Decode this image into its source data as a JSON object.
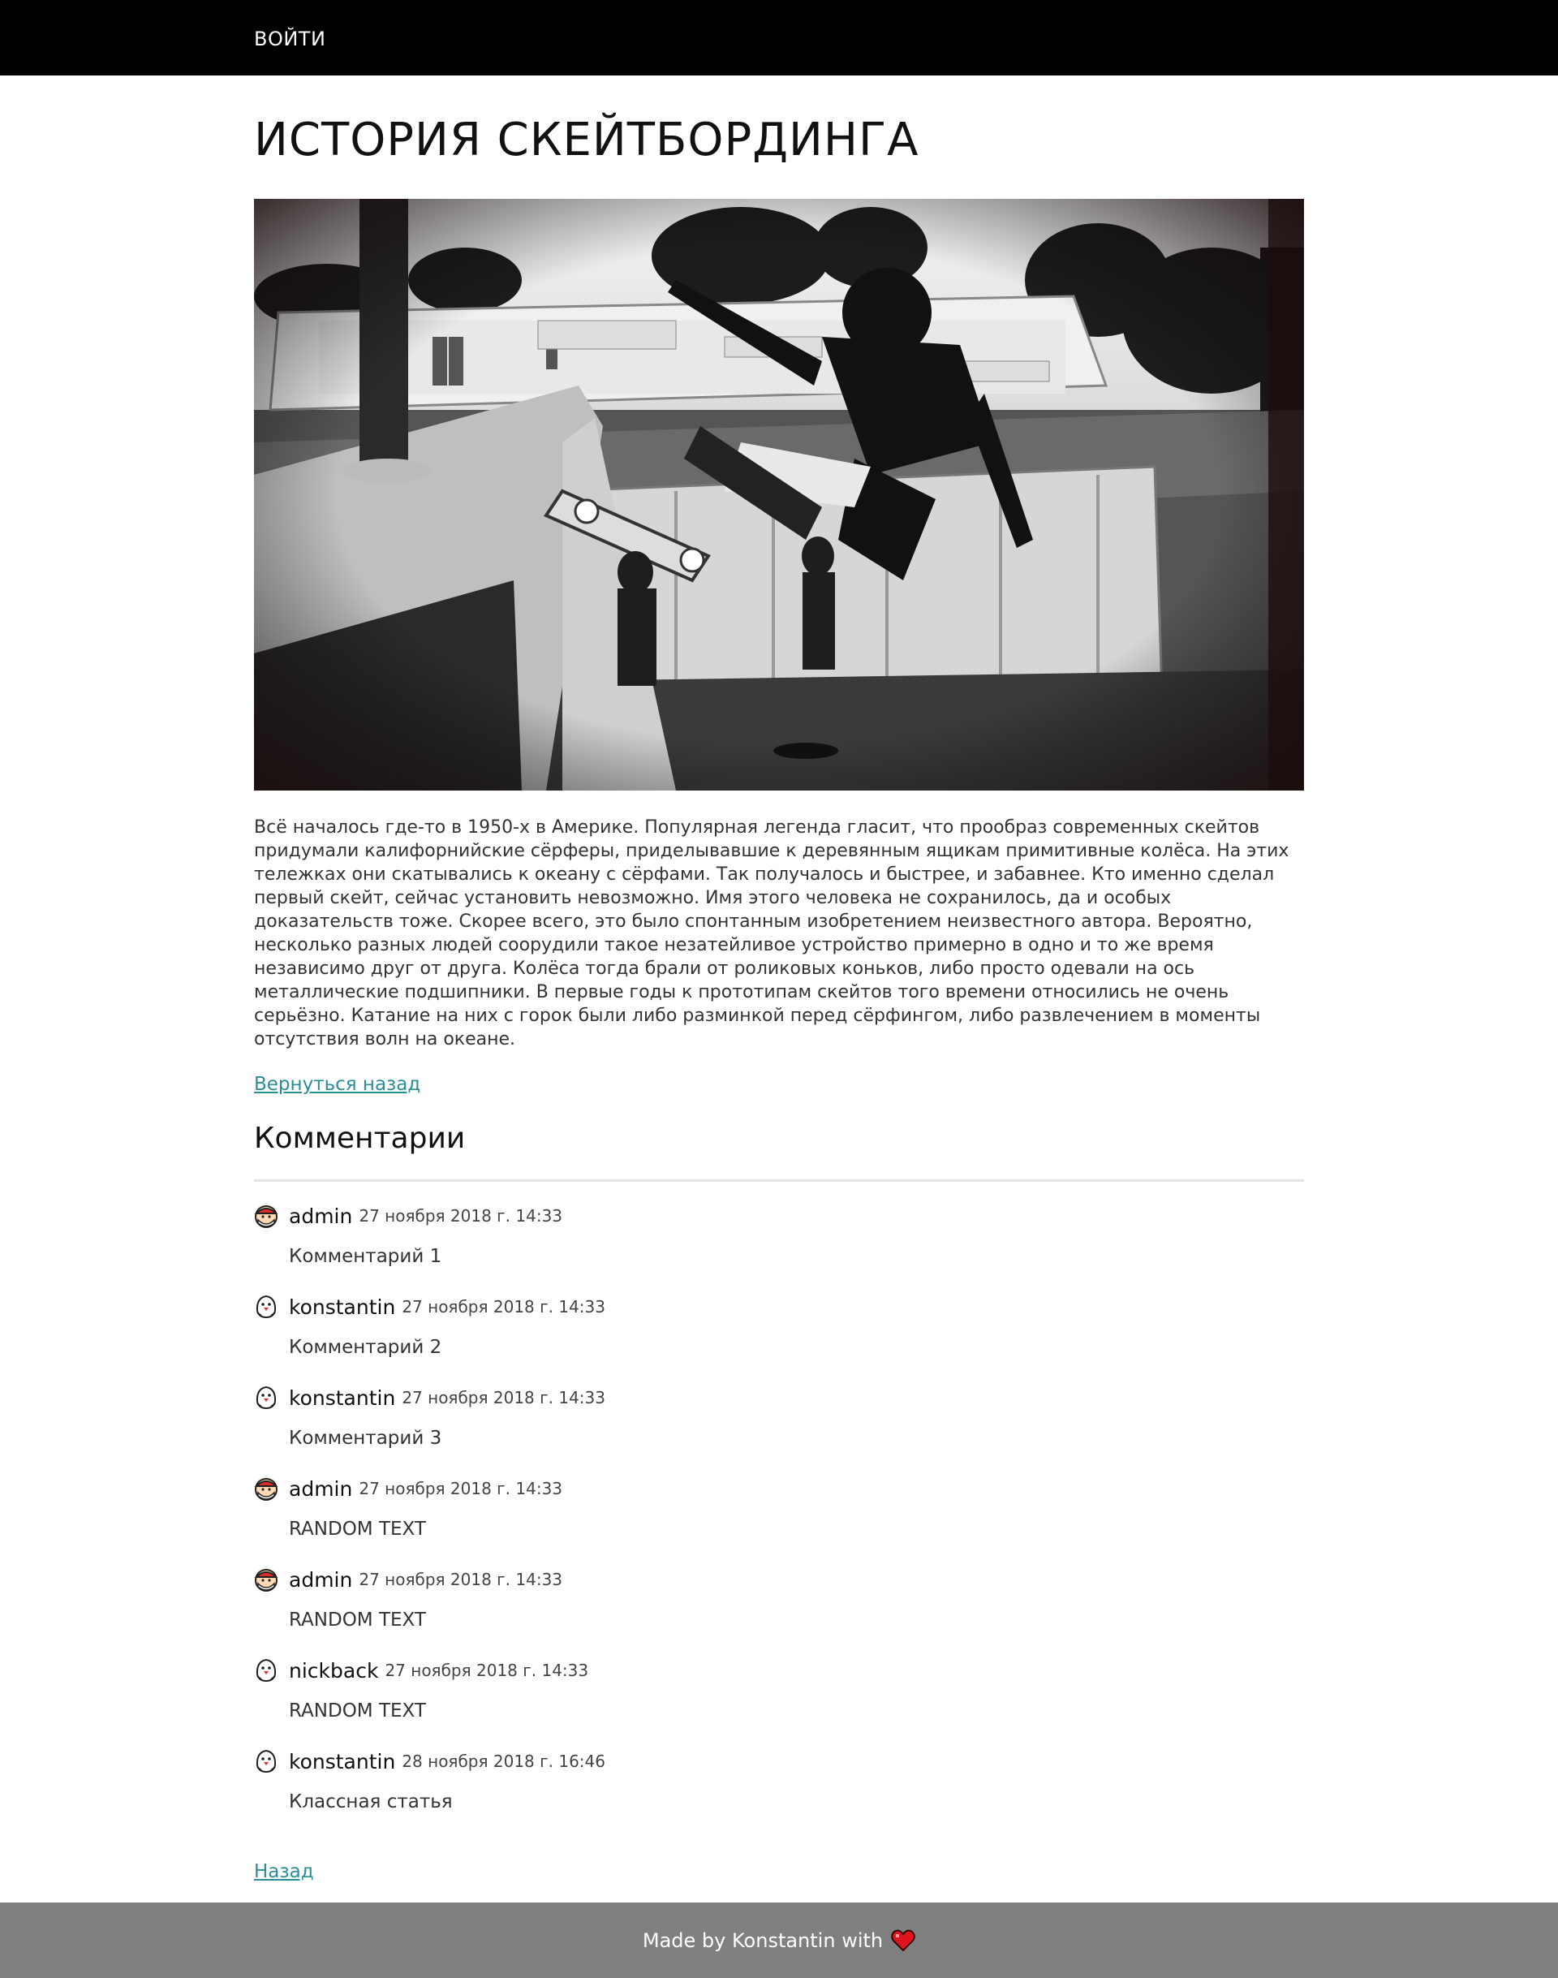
{
  "header": {
    "login_label": "ВОЙТИ"
  },
  "article": {
    "title": "ИСТОРИЯ СКЕЙТБОРДИНГА",
    "body": "Всё началось где-то в 1950-х в Америке. Популярная легенда гласит, что прообраз современных скейтов придумали калифорнийские сёрферы, приделывавшие к деревянным ящикам примитивные колёса. На этих тележках они скатывались к океану с сёрфами. Так получалось и быстрее, и забавнее. Кто именно сделал первый скейт, сейчас установить невозможно. Имя этого человека не сохранилось, да и особых доказательств тоже. Скорее всего, это было спонтанным изобретением неизвестного автора. Вероятно, несколько разных людей соорудили такое незатейливое устройство примерно в одно и то же время независимо друг от друга. Колёса тогда брали от роликовых коньков, либо просто одевали на ось металлические подшипники. В первые годы к прототипам скейтов того времени относились не очень серьёзно. Катание на них с горок были либо разминкой перед сёрфингом, либо развлечением в моменты отсутствия волн на океане.",
    "back_label": "Вернуться назад"
  },
  "comments_section": {
    "title": "Комментарии",
    "items": [
      {
        "author": "admin",
        "date": "27 ноября 2018 г. 14:33",
        "text": "Комментарий 1",
        "avatar": "santa-avatar"
      },
      {
        "author": "konstantin",
        "date": "27 ноября 2018 г. 14:33",
        "text": "Комментарий 2",
        "avatar": "penguin-avatar"
      },
      {
        "author": "konstantin",
        "date": "27 ноября 2018 г. 14:33",
        "text": "Комментарий 3",
        "avatar": "penguin-avatar"
      },
      {
        "author": "admin",
        "date": "27 ноября 2018 г. 14:33",
        "text": "RANDOM TEXT",
        "avatar": "santa-avatar"
      },
      {
        "author": "admin",
        "date": "27 ноября 2018 г. 14:33",
        "text": "RANDOM TEXT",
        "avatar": "santa-avatar"
      },
      {
        "author": "nickback",
        "date": "27 ноября 2018 г. 14:33",
        "text": "RANDOM TEXT",
        "avatar": "penguin-avatar"
      },
      {
        "author": "konstantin",
        "date": "28 ноября 2018 г. 16:46",
        "text": "Классная статья",
        "avatar": "penguin-avatar"
      }
    ]
  },
  "bottom_back_label": "Назад",
  "footer": {
    "text": "Made by Konstantin with",
    "icon": "heart-icon",
    "heart_color": "#e0141e"
  },
  "colors": {
    "header_bg": "#000000",
    "footer_bg": "#808080",
    "link": "#2a8e96"
  }
}
